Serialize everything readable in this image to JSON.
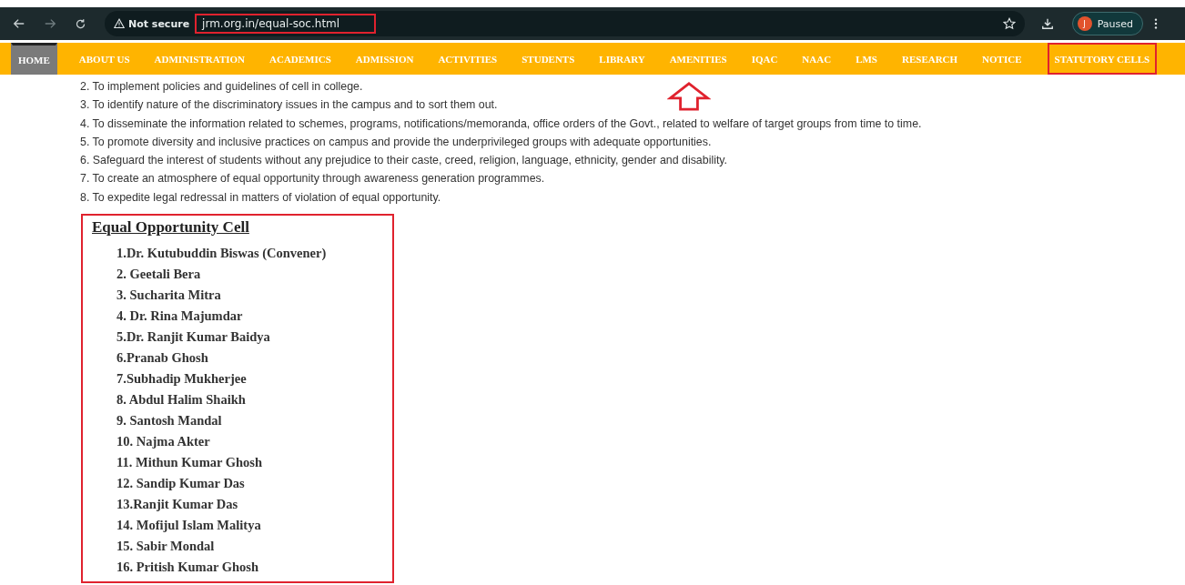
{
  "browser": {
    "security": "Not secure",
    "url": "jrm.org.in/equal-soc.html",
    "url_highlighted": true,
    "profile_initial": "J",
    "profile_status": "Paused"
  },
  "nav": [
    {
      "label": "HOME",
      "selected": true,
      "highlighted": false
    },
    {
      "label": "ABOUT US",
      "selected": false,
      "highlighted": false
    },
    {
      "label": "ADMINISTRATION",
      "selected": false,
      "highlighted": false
    },
    {
      "label": "ACADEMICS",
      "selected": false,
      "highlighted": false
    },
    {
      "label": "ADMISSION",
      "selected": false,
      "highlighted": false
    },
    {
      "label": "ACTIVITIES",
      "selected": false,
      "highlighted": false
    },
    {
      "label": "STUDENTS",
      "selected": false,
      "highlighted": false
    },
    {
      "label": "LIBRARY",
      "selected": false,
      "highlighted": false
    },
    {
      "label": "AMENITIES",
      "selected": false,
      "highlighted": false
    },
    {
      "label": "IQAC",
      "selected": false,
      "highlighted": false
    },
    {
      "label": "NAAC",
      "selected": false,
      "highlighted": false
    },
    {
      "label": "LMS",
      "selected": false,
      "highlighted": false
    },
    {
      "label": "RESEARCH",
      "selected": false,
      "highlighted": false
    },
    {
      "label": "NOTICE",
      "selected": false,
      "highlighted": false
    },
    {
      "label": "STATUTORY CELLS",
      "selected": false,
      "highlighted": true
    }
  ],
  "objectives": [
    "2. To implement policies and guidelines of cell in college.",
    "3. To identify nature of the discriminatory issues in the campus and to sort them out.",
    "4. To disseminate the information related to schemes, programs, notifications/memoranda, office orders of the Govt., related to welfare of target groups from time to time.",
    "5. To promote diversity and inclusive practices on campus and provide the underprivileged groups with adequate opportunities.",
    "6. Safeguard the interest of students without any prejudice to their caste, creed, religion, language, ethnicity, gender and disability.",
    "7. To create an atmosphere of equal opportunity through awareness generation programmes.",
    "8. To expedite legal redressal in matters of violation of equal opportunity."
  ],
  "cell": {
    "title": "Equal Opportunity Cell",
    "highlighted": true,
    "members": [
      "1.Dr. Kutubuddin Biswas (Convener)",
      "2. Geetali Bera",
      "3. Sucharita Mitra",
      "4. Dr. Rina Majumdar",
      "5.Dr. Ranjit Kumar Baidya",
      "6.Pranab Ghosh",
      "7.Subhadip Mukherjee",
      "8. Abdul Halim Shaikh",
      "9. Santosh Mandal",
      "10. Najma Akter",
      "11. Mithun Kumar Ghosh",
      "12. Sandip Kumar Das",
      "13.Ranjit Kumar Das",
      "14. Mofijul Islam Malitya",
      "15. Sabir Mondal",
      "16. Pritish Kumar Ghosh"
    ]
  }
}
